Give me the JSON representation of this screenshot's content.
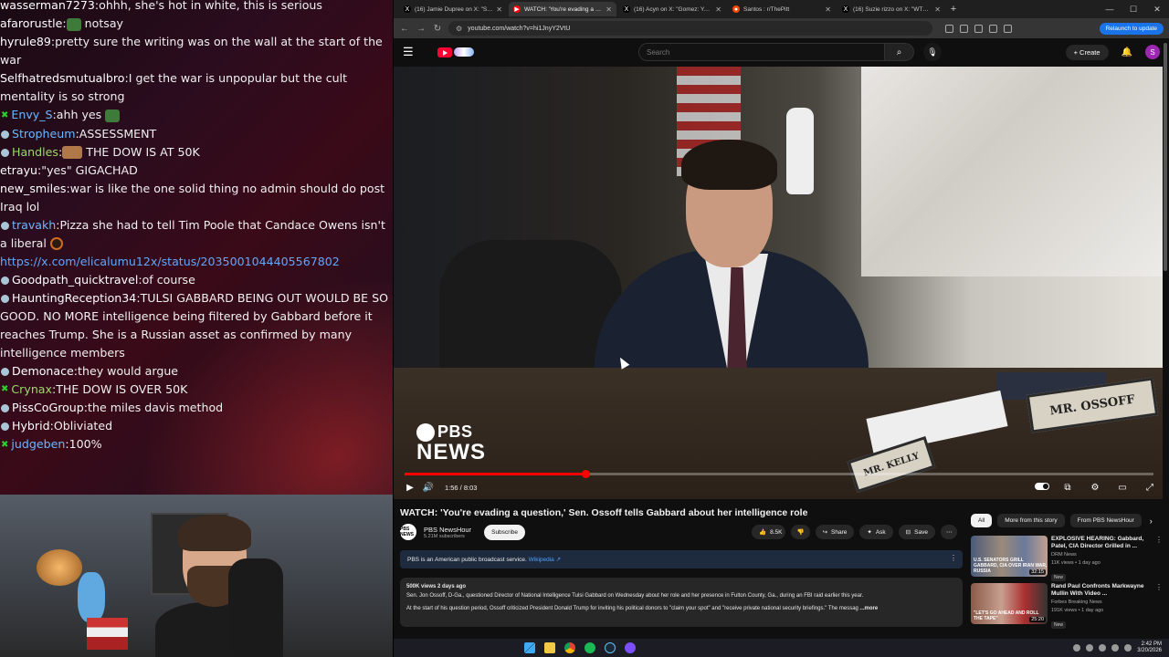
{
  "chat": {
    "messages": [
      {
        "user": "wasserman7273",
        "text": "ohhh, she's hot in white, this is serious",
        "badge": "",
        "color": "white"
      },
      {
        "user": "afarorustle",
        "text": "notsay",
        "badge": "",
        "color": "white",
        "emote_before": "green"
      },
      {
        "user": "hyrule89",
        "text": "pretty sure the writing was on the wall at the start of the war",
        "badge": "",
        "color": "white"
      },
      {
        "user": "Selfhatredsmutualbro",
        "text": "I get the war is unpopular but the cult mentality is so strong",
        "badge": "",
        "color": "white"
      },
      {
        "user": "Envy_S",
        "text": "ahh yes",
        "badge": "k",
        "color": "blue",
        "emote_after": "green"
      },
      {
        "user": "Stropheum",
        "text": "ASSESSMENT",
        "badge": "dot",
        "color": "blue"
      },
      {
        "user": "Handles",
        "text": "THE DOW IS AT 50K",
        "badge": "dot",
        "color": "green",
        "emote_before": "face"
      },
      {
        "user": "etrayu",
        "text": "\"yes\" GIGACHAD",
        "badge": "",
        "color": "white"
      },
      {
        "user": "new_smiles",
        "text": "war is like the one solid thing no admin should do post Iraq lol",
        "badge": "",
        "color": "white"
      },
      {
        "user": "travakh",
        "text": "Pizza she had to tell Tim Poole that Candace Owens isn't a liberal",
        "badge": "dot",
        "color": "blue",
        "emote_after": "ball"
      },
      {
        "user": "",
        "text": "https://x.com/elicalumu12x/status/2035001044405567802",
        "badge": "",
        "color": "link"
      },
      {
        "user": "Goodpath_quicktravel",
        "text": "of course",
        "badge": "dot",
        "color": "white"
      },
      {
        "user": "HauntingReception34",
        "text": "TULSI GABBARD BEING OUT WOULD BE SO GOOD. NO MORE intelligence being filtered by Gabbard before it reaches Trump. She is a Russian asset as confirmed by many intelligence members",
        "badge": "dot",
        "color": "white"
      },
      {
        "user": "Demonace",
        "text": "they would argue",
        "badge": "dot",
        "color": "white"
      },
      {
        "user": "Crynax",
        "text": "THE DOW IS OVER 50K",
        "badge": "k",
        "color": "green"
      },
      {
        "user": "PissCoGroup",
        "text": "the miles davis method",
        "badge": "dot",
        "color": "white"
      },
      {
        "user": "Hybrid",
        "text": "Obliviated",
        "badge": "dot",
        "color": "white"
      },
      {
        "user": "judgeben",
        "text": "100%",
        "badge": "k",
        "color": "blue"
      }
    ]
  },
  "browser": {
    "tabs": [
      {
        "title": "(16) Jamie Dupree on X: \"Sen...",
        "icon": "X",
        "icon_color": "#000000",
        "active": false
      },
      {
        "title": "WATCH: 'You're evading a quest...",
        "icon": "▶",
        "icon_color": "#ff0000",
        "active": true
      },
      {
        "title": "(16) Acyn on X: \"Gomez: You a...",
        "icon": "X",
        "icon_color": "#000000",
        "active": false
      },
      {
        "title": "Santos : r/ThePitt",
        "icon": "●",
        "icon_color": "#ff4500",
        "active": false
      },
      {
        "title": "(16) Suzie rizzo on X: \"WTF is i...",
        "icon": "X",
        "icon_color": "#000000",
        "active": false
      }
    ],
    "url": "youtube.com/watch?v=hi1JnyY2VtU",
    "relaunch_label": "Relaunch to update"
  },
  "youtube": {
    "search_placeholder": "Search",
    "create_label": "Create",
    "avatar_letter": "S",
    "player": {
      "watermark_top": "PBS",
      "watermark_bottom": "NEWS",
      "time_current": "1:56",
      "time_total": "8:03",
      "time_display": "1:56 / 8:03",
      "progress_fraction": 0.241,
      "nameplate_main": "MR. OSSOFF",
      "nameplate_secondary": "MR. KELLY"
    },
    "video": {
      "title": "WATCH: 'You're evading a question,' Sen. Ossoff tells Gabbard about her intelligence role",
      "channel": "PBS NewsHour",
      "subscribers": "5.21M subscribers",
      "channel_avatar_text": "PBS NEWS",
      "subscribe_label": "Subscribe",
      "likes": "8.5K",
      "share_label": "Share",
      "ask_label": "Ask",
      "save_label": "Save",
      "info_text": "PBS is an American public broadcast service.",
      "info_link": "Wikipedia ↗",
      "views_date": "500K views  2 days ago",
      "desc_line1": "Sen. Jon Ossoff, D-Ga., questioned Director of National Intelligence Tulsi Gabbard on Wednesday about her role and her presence in Fulton County, Ga., during an FBI raid earlier this year.",
      "desc_line2": "At the start of his question period, Ossoff criticized President Donald Trump for inviting his political donors to \"claim your spot\" and \"receive private national security briefings.\" The messag",
      "more_label": "...more"
    },
    "chips": [
      "All",
      "More from this story",
      "From PBS NewsHour"
    ],
    "recommendations": [
      {
        "title": "EXPLOSIVE HEARING: Gabbard, Patel, CIA Director Grilled in ...",
        "channel": "DRM News",
        "meta": "11K views • 1 day ago",
        "badge": "New",
        "duration": "32:15",
        "caption": "U.S. Senators Grill Gabbard, CIA Over Iran War, Russia"
      },
      {
        "title": "Rand Paul Confronts Markwayne Mullin With Video ...",
        "channel": "Forbes Breaking News",
        "meta": "191K views • 1 day ago",
        "badge": "New",
        "duration": "25:20",
        "caption": "\"LET'S GO AHEAD AND ROLL THE TAPE\""
      }
    ]
  },
  "taskbar": {
    "time": "2:42 PM",
    "date": "3/20/2026"
  }
}
